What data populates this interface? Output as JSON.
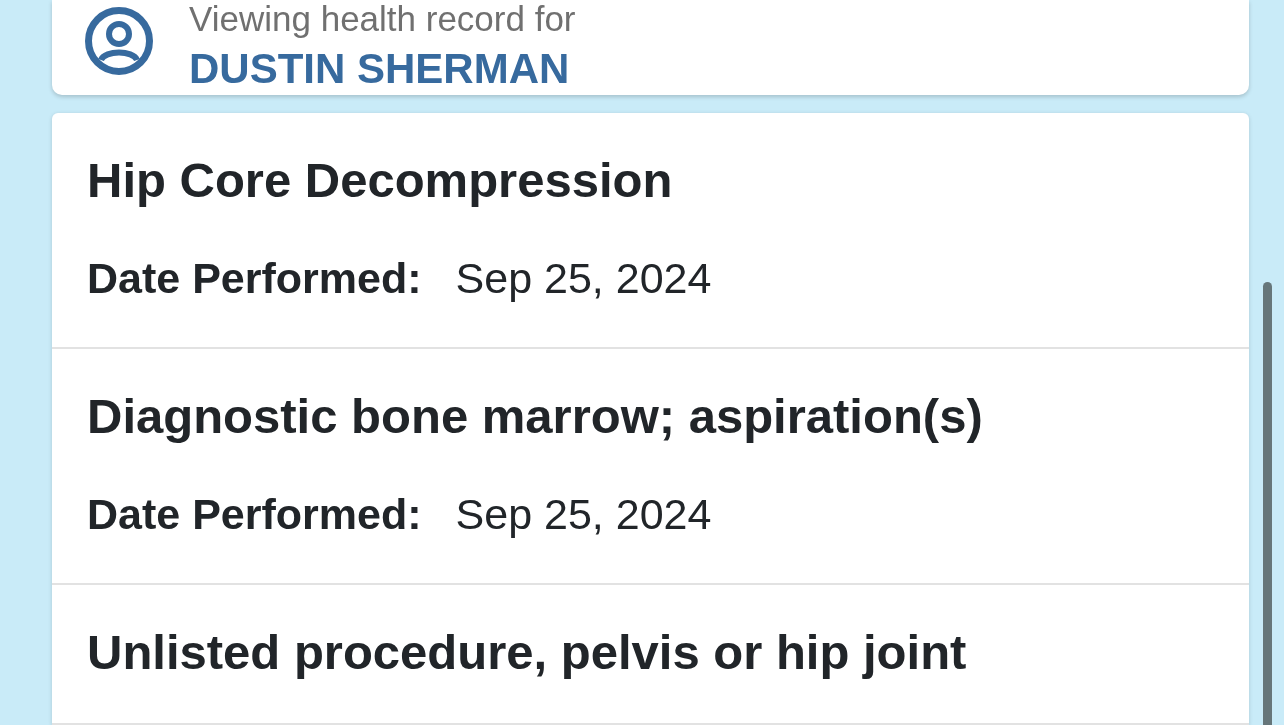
{
  "patient_banner": {
    "caption": "Viewing health record for",
    "name": "DUSTIN SHERMAN"
  },
  "procedures": [
    {
      "title": "Hip Core Decompression",
      "date_label": "Date Performed:",
      "date": "Sep 25, 2024"
    },
    {
      "title": "Diagnostic bone marrow; aspiration(s)",
      "date_label": "Date Performed:",
      "date": "Sep 25, 2024"
    },
    {
      "title": "Unlisted procedure, pelvis or hip joint"
    }
  ]
}
